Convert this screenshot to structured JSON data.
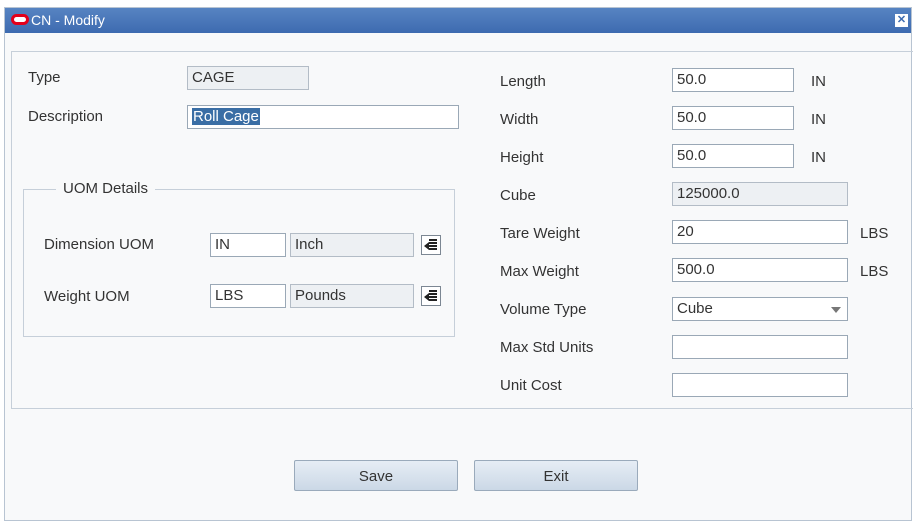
{
  "window": {
    "title": "CN - Modify"
  },
  "left": {
    "type_label": "Type",
    "type_value": "CAGE",
    "description_label": "Description",
    "description_value": "Roll Cage"
  },
  "uom": {
    "legend": "UOM Details",
    "dimension_label": "Dimension UOM",
    "dimension_code": "IN",
    "dimension_desc": "Inch",
    "weight_label": "Weight UOM",
    "weight_code": "LBS",
    "weight_desc": "Pounds"
  },
  "right": {
    "length_label": "Length",
    "length_value": "50.0",
    "length_unit": "IN",
    "width_label": "Width",
    "width_value": "50.0",
    "width_unit": "IN",
    "height_label": "Height",
    "height_value": "50.0",
    "height_unit": "IN",
    "cube_label": "Cube",
    "cube_value": "125000.0",
    "tare_label": "Tare Weight",
    "tare_value": "20",
    "tare_unit": "LBS",
    "max_weight_label": "Max Weight",
    "max_weight_value": "500.0",
    "max_weight_unit": "LBS",
    "volume_type_label": "Volume Type",
    "volume_type_value": "Cube",
    "max_std_units_label": "Max Std Units",
    "max_std_units_value": "",
    "unit_cost_label": "Unit Cost",
    "unit_cost_value": ""
  },
  "buttons": {
    "save": "Save",
    "exit": "Exit"
  },
  "colors": {
    "titlebar": "#4a77b8",
    "selection": "#3a6ea5",
    "logo": "#e3001b"
  },
  "icons": {
    "close": "close-icon",
    "logo": "oracle-logo-icon",
    "lov": "list-of-values-icon"
  }
}
